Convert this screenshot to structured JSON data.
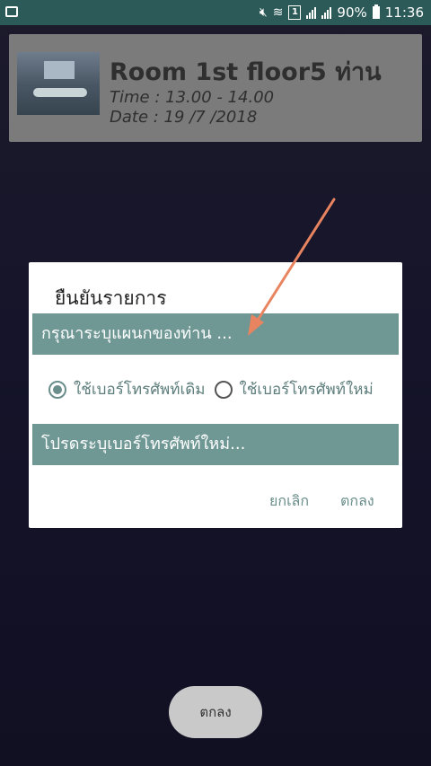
{
  "status_bar": {
    "battery": "90%",
    "time": "11:36",
    "sim_badge": "1",
    "icons": [
      "gallery-icon",
      "mute-icon",
      "wifi-icon",
      "sim-icon",
      "signal-icon",
      "signal-icon-2",
      "battery-icon"
    ]
  },
  "room_card": {
    "title": "Room 1st floor5 ท่าน",
    "time": "Time : 13.00 - 14.00",
    "date": "Date : 19 /7 /2018"
  },
  "dialog": {
    "title": "ยืนยันรายการ",
    "department_placeholder": "กรุณาระบุแผนกของท่าน ...",
    "radio_options": [
      {
        "label": "ใช้เบอร์โทรศัพท์เดิม",
        "selected": true
      },
      {
        "label": "ใช้เบอร์โทรศัพท์ใหม่",
        "selected": false
      }
    ],
    "phone_placeholder": "โปรดระบุเบอร์โทรศัพท์ใหม่...",
    "cancel_label": "ยกเลิก",
    "ok_label": "ตกลง"
  },
  "bottom_button": {
    "label": "ตกลง"
  },
  "colors": {
    "status_bar": "#2c5a58",
    "field_bg": "#6f9895",
    "accent": "#6a8e8b",
    "annotation_arrow": "#e8845f"
  }
}
